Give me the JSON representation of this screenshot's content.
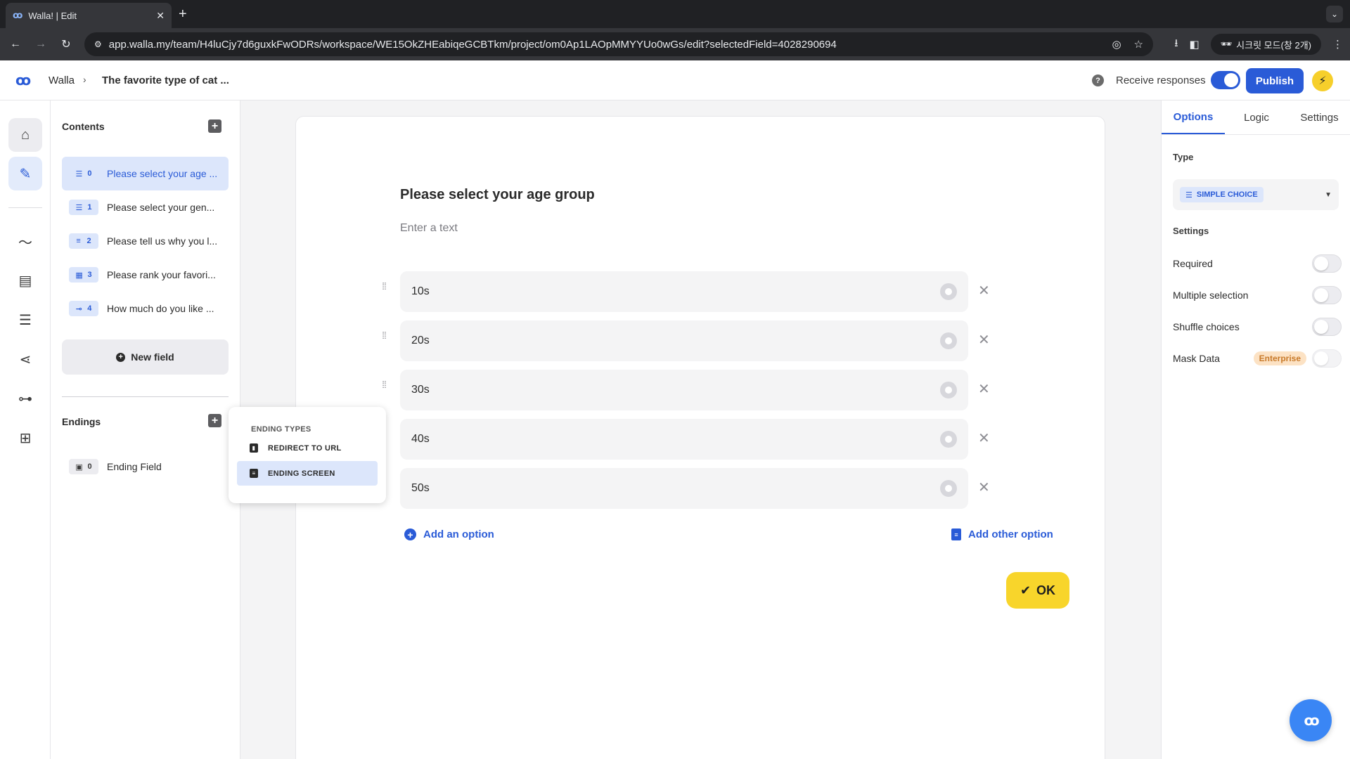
{
  "browser": {
    "tab_title": "Walla! | Edit",
    "favicon": "ꝏ",
    "url": "app.walla.my/team/H4luCjy7d6guxkFwODRs/workspace/WE15OkZHEabiqeGCBTkm/project/om0Ap1LAOpMMYYUo0wGs/edit?selectedField=4028290694",
    "incognito_label": "시크릿 모드(창 2개)"
  },
  "header": {
    "logo": "ꝏ",
    "breadcrumb_home": "Walla",
    "breadcrumb_title": "The favorite type of cat ...",
    "receive_label": "Receive responses",
    "receive_on": true,
    "publish_label": "Publish"
  },
  "contents": {
    "title": "Contents",
    "fields": [
      {
        "index": "0",
        "label": "Please select your age ...",
        "icon": "list-icon",
        "active": true
      },
      {
        "index": "1",
        "label": "Please select your gen...",
        "icon": "list-icon",
        "active": false
      },
      {
        "index": "2",
        "label": "Please tell us why you l...",
        "icon": "text-lines-icon",
        "active": false
      },
      {
        "index": "3",
        "label": "Please rank your favori...",
        "icon": "grid-icon",
        "active": false
      },
      {
        "index": "4",
        "label": "How much do you like ...",
        "icon": "slider-icon",
        "active": false
      }
    ],
    "new_field_label": "New field",
    "endings_title": "Endings",
    "endings": [
      {
        "index": "0",
        "label": "Ending Field"
      }
    ]
  },
  "popup": {
    "title": "ENDING TYPES",
    "items": [
      {
        "label": "REDIRECT TO URL",
        "active": false
      },
      {
        "label": "ENDING SCREEN",
        "active": true
      }
    ]
  },
  "editor": {
    "question": "Please select your age group",
    "description_placeholder": "Enter a text",
    "options": [
      "10s",
      "20s",
      "30s",
      "40s",
      "50s"
    ],
    "add_option_label": "Add an option",
    "add_other_label": "Add other option",
    "ok_label": "OK"
  },
  "rightpanel": {
    "tabs": [
      "Options",
      "Logic",
      "Settings"
    ],
    "active_tab": "Options",
    "type_label": "Type",
    "type_value": "SIMPLE CHOICE",
    "settings_label": "Settings",
    "settings": [
      {
        "label": "Required",
        "on": false
      },
      {
        "label": "Multiple selection",
        "on": false
      },
      {
        "label": "Shuffle choices",
        "on": false
      },
      {
        "label": "Mask Data",
        "on": false,
        "badge": "Enterprise"
      }
    ]
  },
  "colors": {
    "accent": "#2a5bd7",
    "ok_button": "#f8d52b",
    "enterprise_badge": "#fce2c4"
  }
}
